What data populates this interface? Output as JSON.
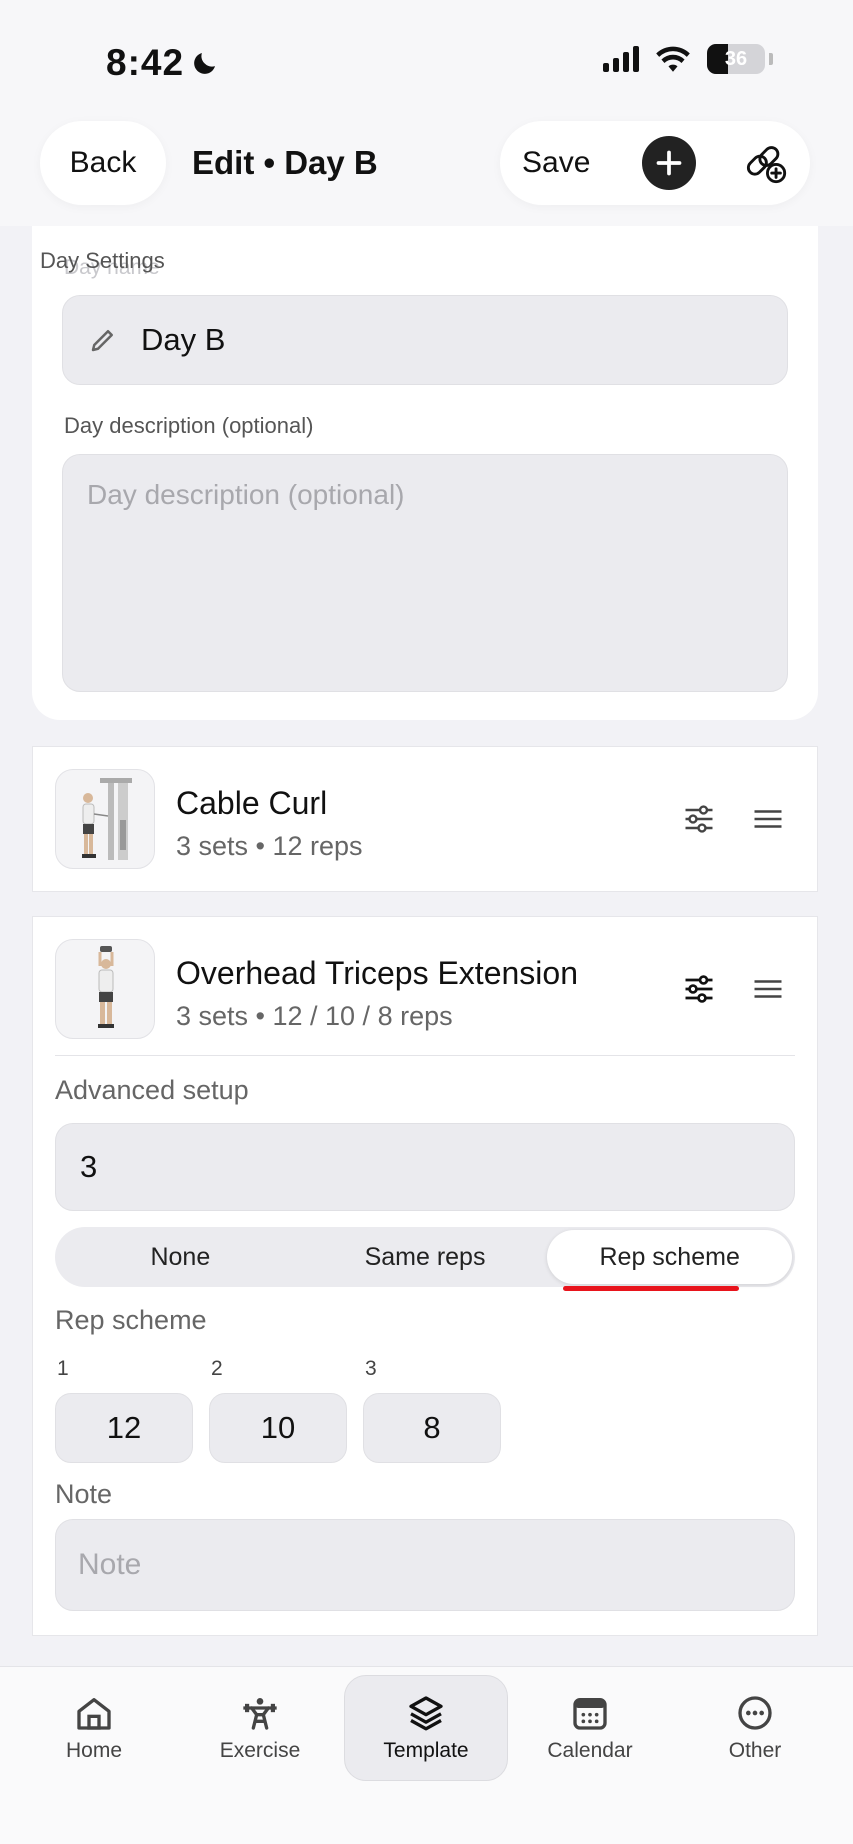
{
  "status_bar": {
    "time": "8:42",
    "battery": "36",
    "battery_level": 0.36
  },
  "header": {
    "back_label": "Back",
    "title": "Edit • Day B",
    "save_label": "Save"
  },
  "day_settings": {
    "section_title": "Day Settings",
    "name_label": "Day name",
    "name_value": "Day B",
    "description_label": "Day description (optional)",
    "description_placeholder": "Day description (optional)"
  },
  "exercises": [
    {
      "name": "Cable Curl",
      "meta": "3 sets • 12 reps"
    },
    {
      "name": "Overhead Triceps Extension",
      "meta": "3 sets • 12 / 10 / 8 reps",
      "advanced_label": "Advanced setup",
      "sets_value": "3",
      "modes": [
        "None",
        "Same reps",
        "Rep scheme"
      ],
      "selected_mode": "Rep scheme",
      "scheme_label": "Rep scheme",
      "reps": [
        {
          "index": "1",
          "value": "12"
        },
        {
          "index": "2",
          "value": "10"
        },
        {
          "index": "3",
          "value": "8"
        }
      ],
      "note_label": "Note",
      "note_placeholder": "Note"
    }
  ],
  "tabs": [
    {
      "label": "Home",
      "icon": "home-icon"
    },
    {
      "label": "Exercise",
      "icon": "weightlifter-icon"
    },
    {
      "label": "Template",
      "icon": "layers-icon",
      "active": true
    },
    {
      "label": "Calendar",
      "icon": "calendar-icon"
    },
    {
      "label": "Other",
      "icon": "more-icon"
    }
  ],
  "colors": {
    "accent_underline": "#e8141c",
    "add_button": "#222222"
  }
}
